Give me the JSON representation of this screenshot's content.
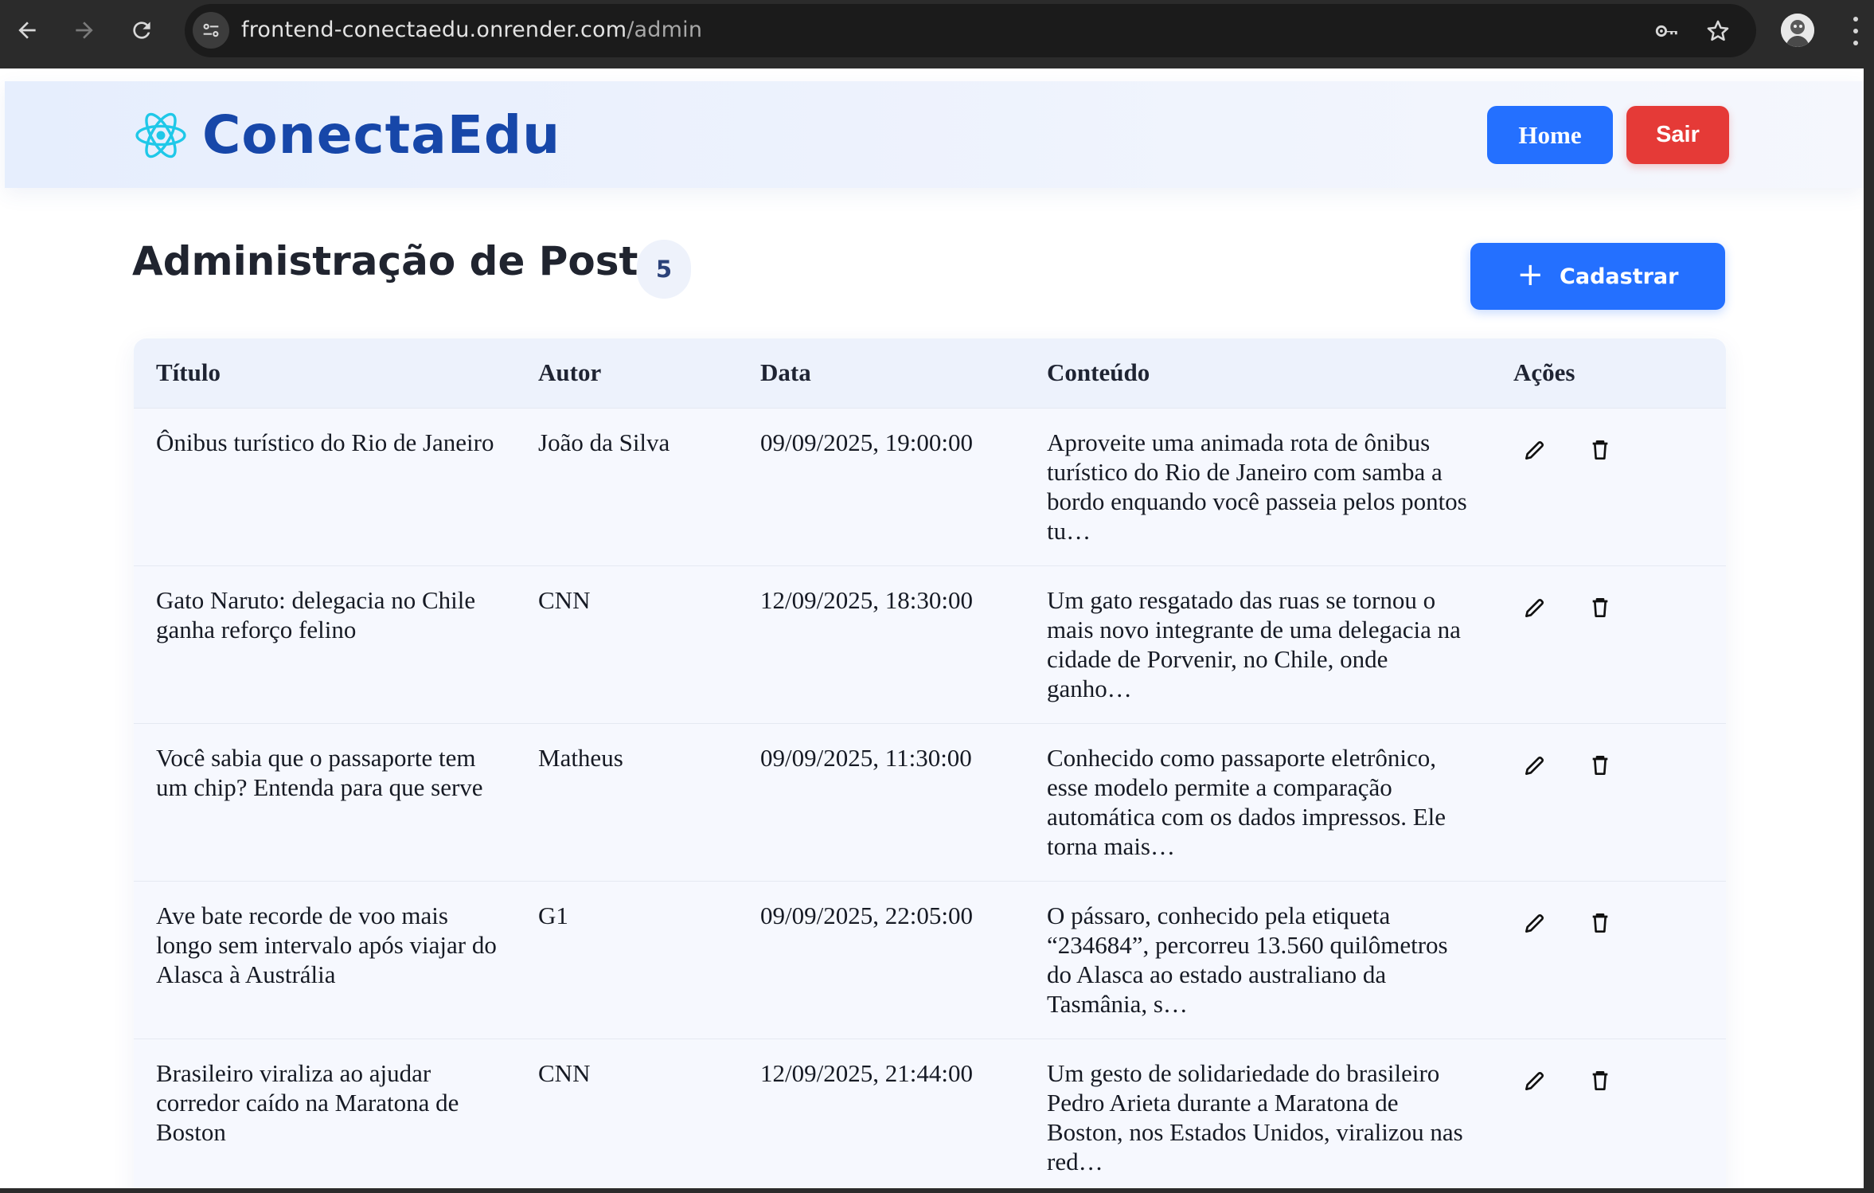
{
  "browser": {
    "url_host": "frontend-conectaedu.onrender.com",
    "url_path": "/admin"
  },
  "header": {
    "brand": "ConectaEdu",
    "logo_icon": "react-atom-icon",
    "home_label": "Home",
    "logout_label": "Sair"
  },
  "page": {
    "title": "Administração de Posts",
    "count": "5",
    "create_label": "Cadastrar"
  },
  "table": {
    "columns": [
      "Título",
      "Autor",
      "Data",
      "Conteúdo",
      "Ações"
    ],
    "rows": [
      {
        "title": "Ônibus turístico do Rio de Janeiro",
        "author": "João da Silva",
        "date": "09/09/2025, 19:00:00",
        "content": "Aproveite uma animada rota de ônibus turístico do Rio de Janeiro com samba a bordo enquando você passeia pelos pontos tu…"
      },
      {
        "title": "Gato Naruto: delegacia no Chile ganha reforço felino",
        "author": "CNN",
        "date": "12/09/2025, 18:30:00",
        "content": "Um gato resgatado das ruas se tornou o mais novo integrante de uma delegacia na cidade de Porvenir, no Chile, onde ganho…"
      },
      {
        "title": "Você sabia que o passaporte tem um chip? Entenda para que serve",
        "author": "Matheus",
        "date": "09/09/2025, 11:30:00",
        "content": "Conhecido como passaporte eletrônico, esse modelo permite a comparação automática com os dados impressos. Ele torna mais…"
      },
      {
        "title": "Ave bate recorde de voo mais longo sem intervalo após viajar do Alasca à Austrália",
        "author": "G1",
        "date": "09/09/2025, 22:05:00",
        "content": "O pássaro, conhecido pela etiqueta “234684”, percorreu 13.560 quilômetros do Alasca ao estado australiano da Tasmânia, s…"
      },
      {
        "title": "Brasileiro viraliza ao ajudar corredor caído na Maratona de Boston",
        "author": "CNN",
        "date": "12/09/2025, 21:44:00",
        "content": "Um gesto de solidariedade do brasileiro Pedro Arieta durante a Maratona de Boston, nos Estados Unidos, viralizou nas red…"
      }
    ]
  },
  "colors": {
    "brand": "#1747a9",
    "primary": "#2470ff",
    "danger": "#e53a37",
    "logo_accent": "#1fc8e8"
  }
}
